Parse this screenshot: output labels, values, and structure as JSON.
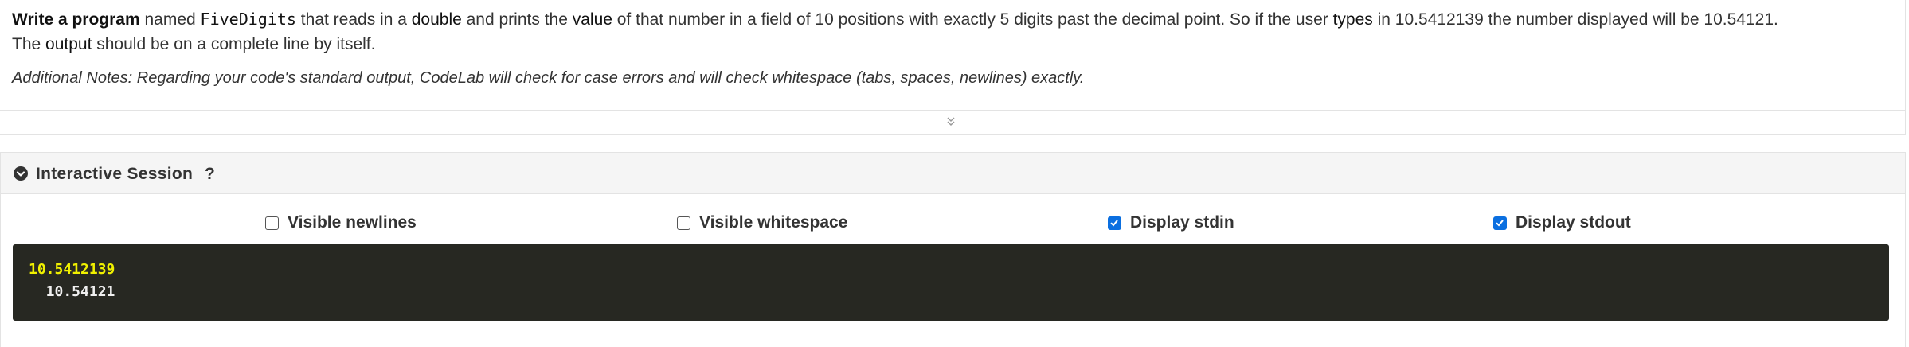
{
  "problem": {
    "text_parts": {
      "p1": "Write a program",
      "p2": " named ",
      "p3": "FiveDigits",
      "p4": " that reads in a ",
      "p5": "double",
      "p6": " and prints the ",
      "p7": "value",
      "p8": " of that number in a field of 10 positions with exactly 5 digits past the decimal point. So if the user ",
      "p9": "types",
      "p10": " in 10.5412139 the number displayed will be 10.54121.",
      "p11": "The ",
      "p12": "output",
      "p13": " should be on a complete line by itself."
    },
    "notes": "Additional Notes: Regarding your code's standard output, CodeLab will check for case errors and will check whitespace (tabs, spaces, newlines) exactly.",
    "expand_icon": "double-chevron-down-icon"
  },
  "session": {
    "title": "Interactive Session",
    "help": "?",
    "toggle_icon": "chevron-down-circle-icon",
    "options": {
      "visible_newlines": {
        "label": "Visible newlines",
        "checked": false
      },
      "visible_whitespace": {
        "label": "Visible whitespace",
        "checked": false
      },
      "display_stdin": {
        "label": "Display stdin",
        "checked": true
      },
      "display_stdout": {
        "label": "Display stdout",
        "checked": true
      }
    },
    "terminal": {
      "stdin": "10.5412139",
      "stdout": "  10.54121"
    },
    "colors": {
      "checkbox_accent": "#0b6fe0",
      "terminal_bg": "#272822",
      "stdin_color": "#f0f000",
      "stdout_color": "#f0f0f0"
    }
  }
}
